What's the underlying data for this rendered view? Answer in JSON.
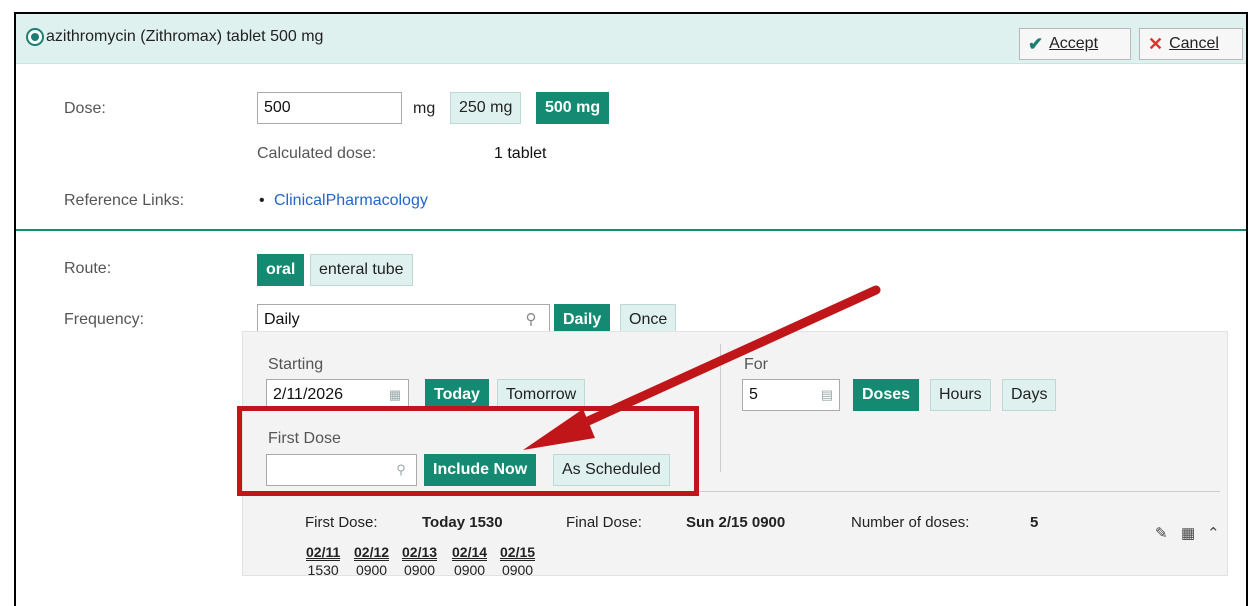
{
  "header": {
    "title": "azithromycin (Zithromax) tablet 500 mg",
    "accept_label": "Accept",
    "cancel_label": "Cancel"
  },
  "dose": {
    "label": "Dose:",
    "value": "500",
    "unit": "mg",
    "presets": [
      "250 mg",
      "500 mg"
    ],
    "selected_preset": "500 mg",
    "calc_label": "Calculated dose:",
    "calc_value": "1 tablet"
  },
  "reference": {
    "label": "Reference Links:",
    "link": "ClinicalPharmacology"
  },
  "route": {
    "label": "Route:",
    "options": [
      "oral",
      "enteral tube"
    ],
    "selected": "oral"
  },
  "frequency": {
    "label": "Frequency:",
    "value": "Daily",
    "options": [
      "Daily",
      "Once"
    ],
    "selected": "Daily"
  },
  "starting": {
    "label": "Starting",
    "date": "2/11/2026",
    "options": [
      "Today",
      "Tomorrow"
    ],
    "selected": "Today"
  },
  "duration": {
    "label": "For",
    "value": "5",
    "options": [
      "Doses",
      "Hours",
      "Days"
    ],
    "selected": "Doses"
  },
  "first_dose": {
    "label": "First Dose",
    "value": "",
    "options": [
      "Include Now",
      "As Scheduled"
    ],
    "selected": "Include Now"
  },
  "summary": {
    "first_label": "First Dose:",
    "first_value": "Today 1530",
    "final_label": "Final Dose:",
    "final_value": "Sun 2/15 0900",
    "count_label": "Number of doses:",
    "count_value": "5",
    "schedule": [
      {
        "date": "02/11",
        "time": "1530"
      },
      {
        "date": "02/12",
        "time": "0900"
      },
      {
        "date": "02/13",
        "time": "0900"
      },
      {
        "date": "02/14",
        "time": "0900"
      },
      {
        "date": "02/15",
        "time": "0900"
      }
    ]
  },
  "colors": {
    "accent": "#148a72",
    "chip_bg": "#dff1ee",
    "link": "#2266cc",
    "callout": "#c0161a"
  },
  "icons": {
    "search": "magnifier",
    "calendar": "calendar",
    "pencil": "pencil",
    "collapse": "double-chevron-up"
  }
}
